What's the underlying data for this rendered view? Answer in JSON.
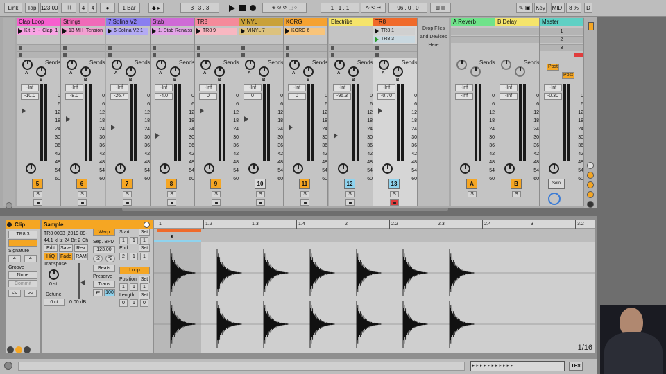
{
  "toolbar": {
    "link": "Link",
    "tap": "Tap",
    "tempo": "123.00",
    "sig_num": "4",
    "sig_den": "4",
    "metro": "●",
    "quantize": "1 Bar",
    "position": "3 .   3 .   3",
    "loop_start": "1 .   1 .   1",
    "loop_len": "96 .   0 .   0",
    "key": "Key",
    "midi": "MIDI",
    "cpu": "8 %",
    "d": "D"
  },
  "tracks": [
    {
      "name": "Clap Loop",
      "color": "#f75fce",
      "clip": "Kit_8_-_Clap_1",
      "vol": "-10.0",
      "num": "5",
      "state": "on",
      "clipcolor": "#f9a3e4"
    },
    {
      "name": "Strings",
      "color": "#f06ab8",
      "clip": "13-MH_Tension",
      "vol": "-8.0",
      "num": "6",
      "state": "on",
      "clipcolor": "#f3a0d2"
    },
    {
      "name": "7 Solina V2",
      "color": "#8a7ef0",
      "clip": "6-Solina V2 1",
      "vol": "-26.7",
      "num": "7",
      "state": "on",
      "clipcolor": "#b3aaf5"
    },
    {
      "name": "Stab",
      "color": "#cf6ad6",
      "clip": "1. Stab Renaissance",
      "vol": "-4.0",
      "num": "8",
      "state": "on",
      "clipcolor": "#e3a4e7"
    },
    {
      "name": "TR8",
      "color": "#f58a9a",
      "clip": "TR8 9",
      "vol": "0",
      "num": "9",
      "state": "on",
      "clipcolor": "#f8b7c1"
    },
    {
      "name": "VINYL",
      "color": "#c9a13a",
      "clip": "VINYL 7",
      "vol": "0",
      "num": "10",
      "state": "off",
      "clipcolor": "#dcc27e"
    },
    {
      "name": "KORG",
      "color": "#f5a230",
      "clip": "KORG 6",
      "vol": "0",
      "num": "11",
      "state": "on",
      "clipcolor": "#f8c47a"
    },
    {
      "name": "Electribe",
      "color": "#f5e46a",
      "clip": "",
      "vol": "-95.3",
      "num": "12",
      "state": "blue",
      "clipcolor": "#c4c4c4"
    },
    {
      "name": "TR8",
      "color": "#f06a2a",
      "clip": "TR8 1",
      "clip2": "TR8 3",
      "vol": "-0.70",
      "num": "13",
      "state": "blue",
      "clipcolor": "#d0d0d0"
    }
  ],
  "returns": [
    {
      "name": "A Reverb",
      "color": "#6fe38a",
      "vol": "-Inf",
      "btn": "A"
    },
    {
      "name": "B Delay",
      "color": "#f5e46a",
      "vol": "-Inf",
      "btn": "B"
    },
    {
      "name": "Master",
      "color": "#5fd0c4",
      "vol": "-0.30",
      "btn": "Solo",
      "scenes": [
        "1",
        "2",
        "3"
      ],
      "post": "Post"
    }
  ],
  "mixer": {
    "sends": "Sends",
    "inf": "-Inf",
    "zero": "0",
    "scale": [
      "0",
      "6",
      "12",
      "18",
      "24",
      "30",
      "36",
      "42",
      "48",
      "54",
      "60"
    ],
    "drop": [
      "Drop Files",
      "and Devices",
      "Here"
    ]
  },
  "clip_panel": {
    "title": "Clip",
    "name": "TR8 3",
    "signature": "Signature",
    "sig_num": "4",
    "sig_den": "4",
    "groove": "Groove",
    "groove_val": "None",
    "commit": "Commit"
  },
  "sample_panel": {
    "title": "Sample",
    "file": "TR8 0003 [2019-09-",
    "info": "44.1 kHz 24 Bit 2 Ch",
    "edit": "Edit",
    "save": "Save",
    "rev": "Rev.",
    "hiq": "HiQ",
    "fade": "Fade",
    "ram": "RAM",
    "transpose": "Transpose",
    "transpose_val": "0 st",
    "detune": "Detune",
    "detune_val": "0 ct",
    "gain": "0.00 dB",
    "warp": "Warp",
    "seg_bpm": "Seg. BPM",
    "bpm": "123.00",
    "half": ":2",
    "dbl": "*2",
    "beats": "Beats",
    "preserve": "Preserve",
    "trans": "Trans",
    "hundred": "100",
    "start": "Start",
    "end": "End",
    "set": "Set",
    "loop": "Loop",
    "position": "Position",
    "length": "Length",
    "start_vals": [
      "1",
      "1",
      "1"
    ],
    "end_vals": [
      "2",
      "1",
      "1"
    ],
    "pos_vals": [
      "1",
      "1",
      "1"
    ],
    "len_vals": [
      "0",
      "1",
      "0"
    ]
  },
  "timeline": {
    "marks": [
      "1",
      "1.2",
      "1.3",
      "1.4",
      "2",
      "2.2",
      "2.3",
      "2.4",
      "3",
      "3.2"
    ],
    "page": "1/16"
  },
  "footer": {
    "track": "TR8"
  }
}
